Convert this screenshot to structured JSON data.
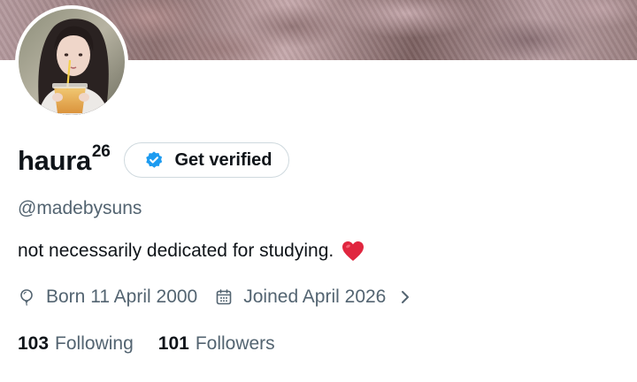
{
  "profile": {
    "display_name": "haura",
    "display_name_superscript": "26",
    "handle": "@madebysuns",
    "bio": "not necessarily dedicated for studying.",
    "bio_emoji": "red-heart",
    "verify_button_label": "Get verified",
    "birthday": "Born 11 April 2000",
    "joined": "Joined April 2026",
    "following_count": "103",
    "following_label": "Following",
    "followers_count": "101",
    "followers_label": "Followers"
  },
  "icons": {
    "verified": "verified-badge-icon",
    "birthday": "balloon-icon",
    "joined": "calendar-icon",
    "more": "chevron-right-icon"
  },
  "colors": {
    "accent": "#1d9bf0",
    "text_primary": "#0f1419",
    "text_secondary": "#536471",
    "border": "#cfd9de",
    "heart": "#e0263f"
  }
}
